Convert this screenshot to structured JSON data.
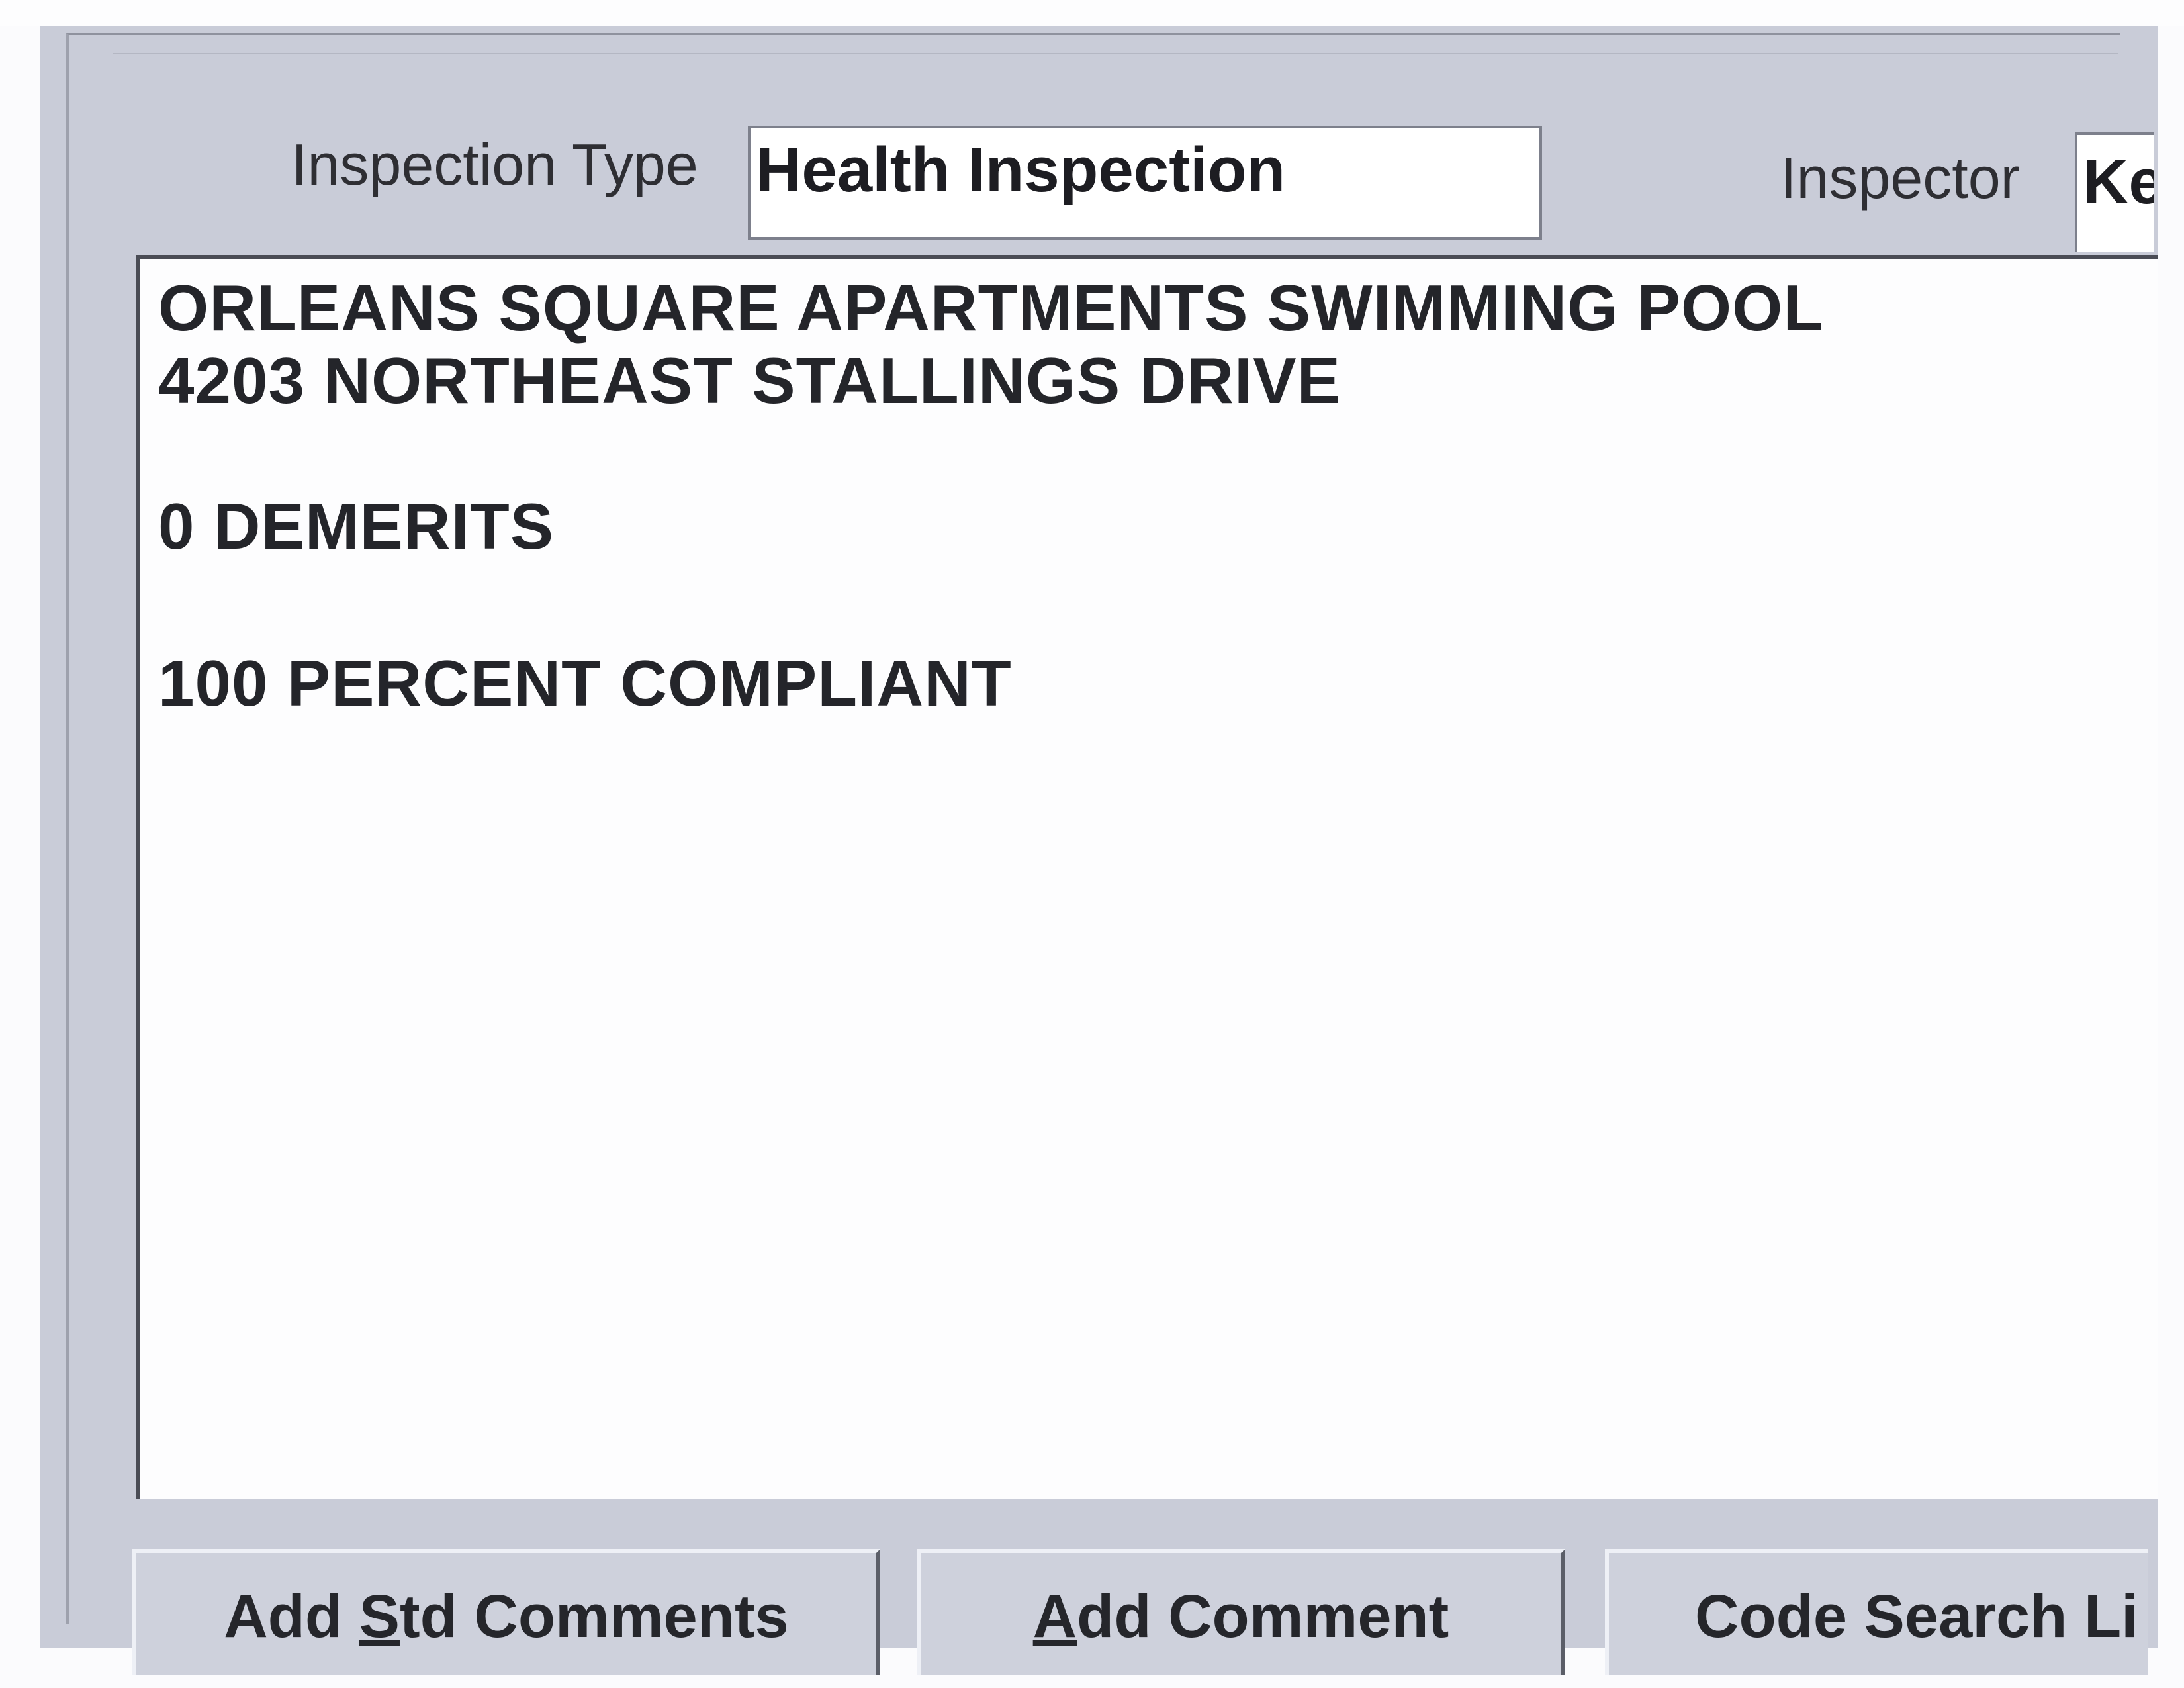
{
  "form": {
    "inspection_type_label": "Inspection Type",
    "inspection_type_value": "Health Inspection",
    "inspector_label": "Inspector",
    "inspector_value": "Ke"
  },
  "comment": {
    "lines": [
      "ORLEANS SQUARE APARTMENTS SWIMMING POOL",
      "4203 NORTHEAST STALLINGS DRIVE",
      "0 DEMERITS",
      "100 PERCENT COMPLIANT"
    ]
  },
  "buttons": {
    "add_std_comments": {
      "pre": "Add ",
      "mnemonic": "S",
      "post": "td Comments"
    },
    "add_comment": {
      "pre": "",
      "mnemonic": "A",
      "post": "dd Comment"
    },
    "code_search": {
      "label": "Code Search Li"
    }
  }
}
